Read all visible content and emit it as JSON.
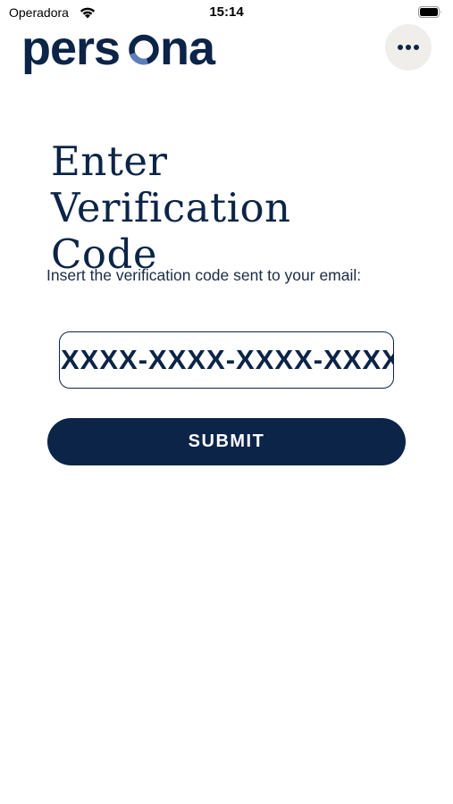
{
  "status_bar": {
    "carrier": "Operadora",
    "time": "15:14",
    "wifi_icon": "wifi-icon",
    "battery_icon": "battery-icon"
  },
  "header": {
    "logo_text": "persona",
    "menu_icon": "more-horizontal-icon"
  },
  "main": {
    "title": "Enter Verification Code",
    "instructions": "Insert the verification code sent to your email:",
    "code_input": {
      "placeholder": "XXXX-XXXX-XXXX-XXXX",
      "value": ""
    },
    "submit_label": "SUBMIT"
  },
  "colors": {
    "brand_navy": "#0b2447",
    "logo_accent": "#4a6fa5",
    "menu_button_bg": "#efeeeb",
    "background": "#ffffff"
  }
}
